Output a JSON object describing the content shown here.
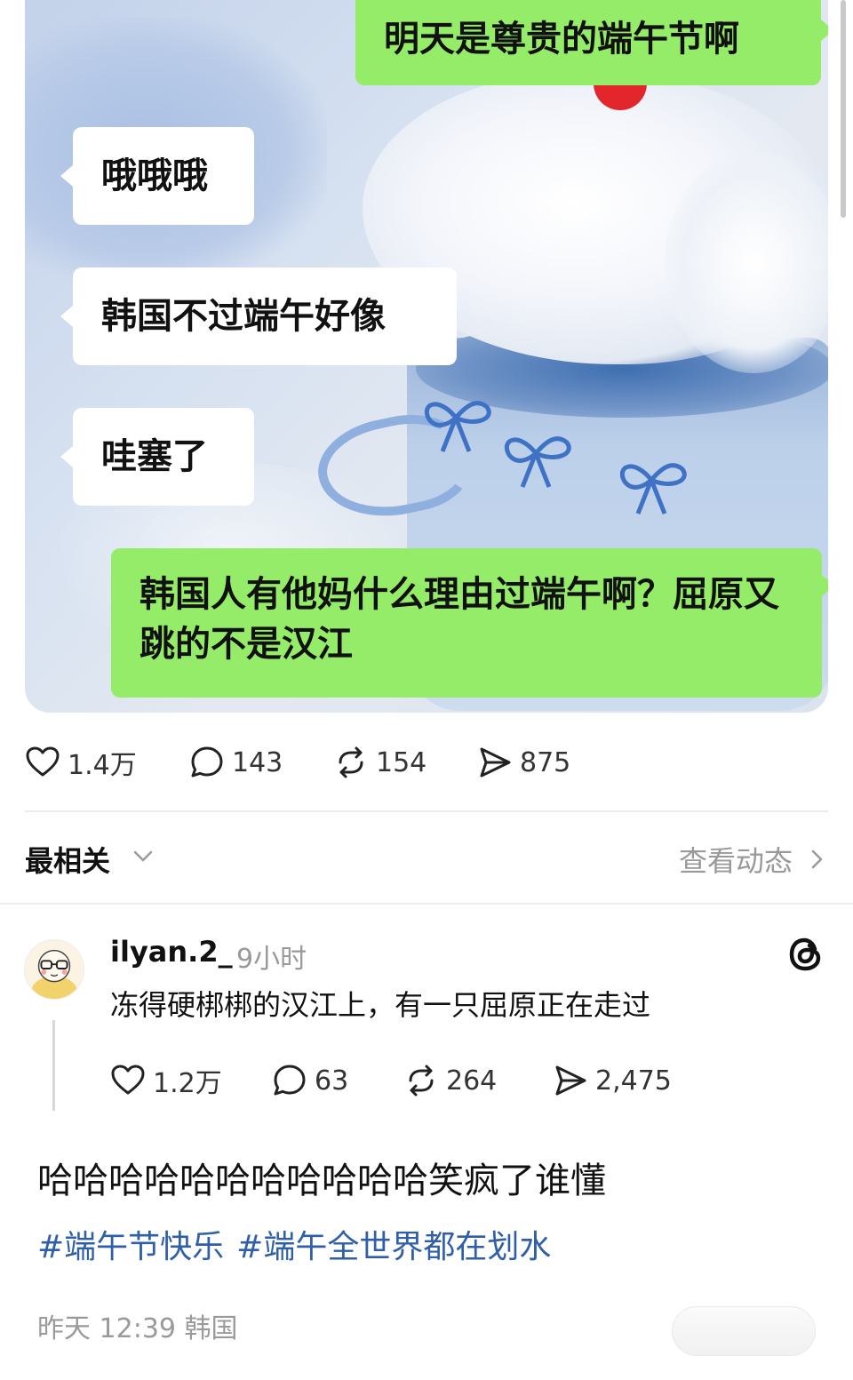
{
  "chat": {
    "messages": [
      {
        "side": "right",
        "text": "明天是尊贵的端午节啊"
      },
      {
        "side": "left",
        "text": "哦哦哦"
      },
      {
        "side": "left",
        "text": "韩国不过端午好像"
      },
      {
        "side": "left",
        "text": "哇塞了"
      },
      {
        "side": "right",
        "text": "韩国人有他妈什么理由过端午啊？屈原又跳的不是汉江"
      }
    ],
    "colors": {
      "green_bubble": "#95ec69",
      "white_bubble": "#ffffff"
    }
  },
  "post_stats": {
    "likes": "1.4万",
    "comments": "143",
    "reposts": "154",
    "shares": "875"
  },
  "sort": {
    "label": "最相关",
    "activity_link": "查看动态"
  },
  "comment": {
    "username": "ilyan.2_",
    "time": "9小时",
    "text": "冻得硬梆梆的汉江上，有一只屈原正在走过",
    "stats": {
      "likes": "1.2万",
      "comments": "63",
      "reposts": "264",
      "shares": "2,475"
    }
  },
  "caption": {
    "text": "哈哈哈哈哈哈哈哈哈哈哈笑疯了谁懂",
    "tags": [
      "#端午节快乐",
      "#端午全世界都在划水"
    ],
    "meta": "昨天 12:39 韩国"
  },
  "icons": {
    "like": "heart-icon",
    "comment": "comment-bubble-icon",
    "repost": "repost-icon",
    "share": "send-icon",
    "platform": "threads-logo-icon"
  },
  "accent": {
    "tag_color": "#2f5fa8"
  }
}
